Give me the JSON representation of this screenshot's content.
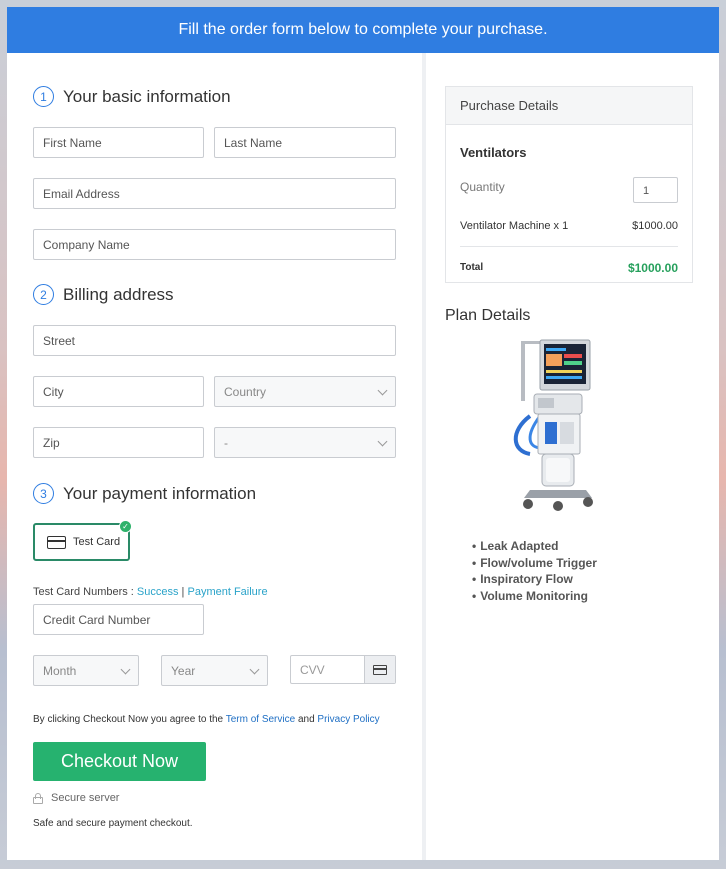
{
  "banner": "Fill the order form below to complete your purchase.",
  "sections": {
    "basic": {
      "num": "1",
      "title": "Your basic information"
    },
    "billing": {
      "num": "2",
      "title": "Billing address"
    },
    "payment": {
      "num": "3",
      "title": "Your payment information"
    }
  },
  "fields": {
    "first_name": "First Name",
    "last_name": "Last Name",
    "email": "Email Address",
    "company": "Company Name",
    "street": "Street",
    "city": "City",
    "country": "Country",
    "zip": "Zip",
    "state": "-",
    "credit_card": "Credit Card Number",
    "month": "Month",
    "year": "Year",
    "cvv": "CVV"
  },
  "payment": {
    "test_card": "Test Card",
    "test_numbers_label": "Test Card Numbers : ",
    "success": "Success",
    "separator": " | ",
    "failure": "Payment Failure"
  },
  "terms": {
    "prefix": "By clicking Checkout Now you agree to the ",
    "terms_link": "Term of Service",
    "and": " and ",
    "privacy_link": "Privacy Policy"
  },
  "checkout_button": "Checkout Now",
  "secure_server": "Secure server",
  "secure_note": "Safe and secure payment checkout.",
  "purchase": {
    "header": "Purchase Details",
    "product": "Ventilators",
    "quantity_label": "Quantity",
    "quantity_value": "1",
    "line_item": "Ventilator Machine x 1",
    "line_price": "$1000.00",
    "total_label": "Total",
    "total_value": "$1000.00"
  },
  "plan": {
    "title": "Plan Details",
    "features": [
      "Leak Adapted",
      "Flow/volume Trigger",
      "Inspiratory Flow",
      "Volume Monitoring"
    ]
  },
  "colors": {
    "accent": "#2f7de1",
    "checkout": "#26b26f",
    "total": "#26a05c"
  }
}
